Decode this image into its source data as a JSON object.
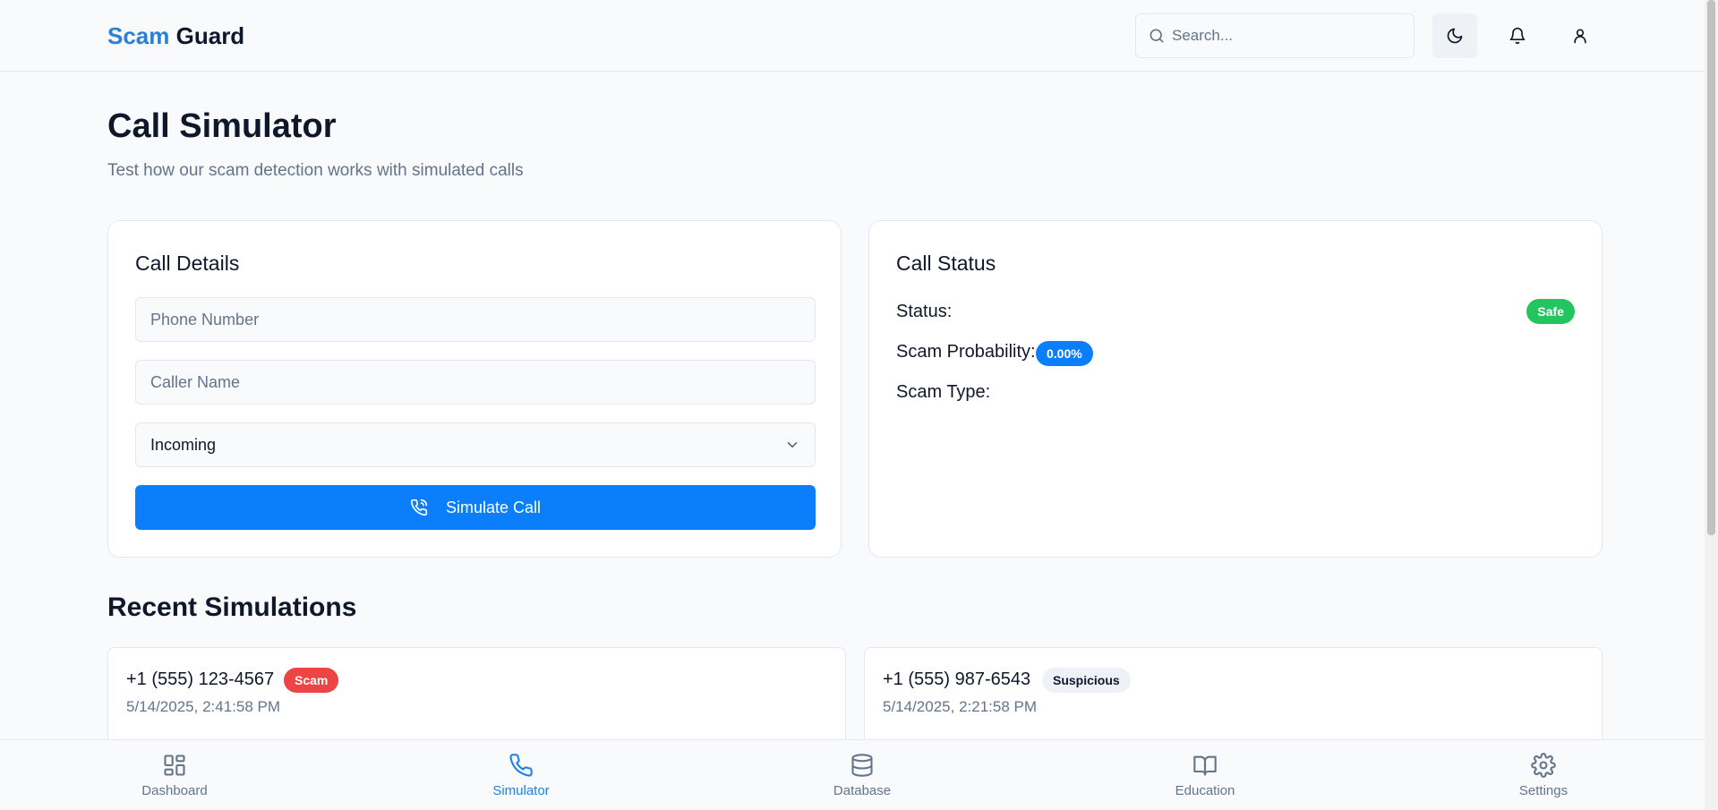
{
  "header": {
    "brand_part1": "Scam",
    "brand_part2": "Guard",
    "search_placeholder": "Search...",
    "icons": [
      "search-icon",
      "moon-icon",
      "bell-icon",
      "user-icon"
    ]
  },
  "page": {
    "title": "Call Simulator",
    "subtitle": "Test how our scam detection works with simulated calls"
  },
  "call_details": {
    "title": "Call Details",
    "phone_placeholder": "Phone Number",
    "name_placeholder": "Caller Name",
    "direction_value": "Incoming",
    "simulate_label": "Simulate Call"
  },
  "call_status": {
    "title": "Call Status",
    "status_label": "Status:",
    "status_value": "Safe",
    "probability_label": "Scam Probability:",
    "probability_value": "0.00%",
    "type_label": "Scam Type:"
  },
  "recent": {
    "title": "Recent Simulations",
    "items": [
      {
        "phone": "+1 (555) 123-4567",
        "badge": "Scam",
        "time": "5/14/2025, 2:41:58 PM"
      },
      {
        "phone": "+1 (555) 987-6543",
        "badge": "Suspicious",
        "time": "5/14/2025, 2:21:58 PM"
      }
    ]
  },
  "nav": {
    "items": [
      {
        "label": "Dashboard",
        "icon": "grid-icon"
      },
      {
        "label": "Simulator",
        "icon": "phone-icon",
        "active": true
      },
      {
        "label": "Database",
        "icon": "database-icon"
      },
      {
        "label": "Education",
        "icon": "book-icon"
      },
      {
        "label": "Settings",
        "icon": "gear-icon"
      }
    ]
  },
  "colors": {
    "brand": "#2b7fd6",
    "primary": "#0b7ffb",
    "safe": "#22c55e",
    "scam": "#ef4444"
  }
}
